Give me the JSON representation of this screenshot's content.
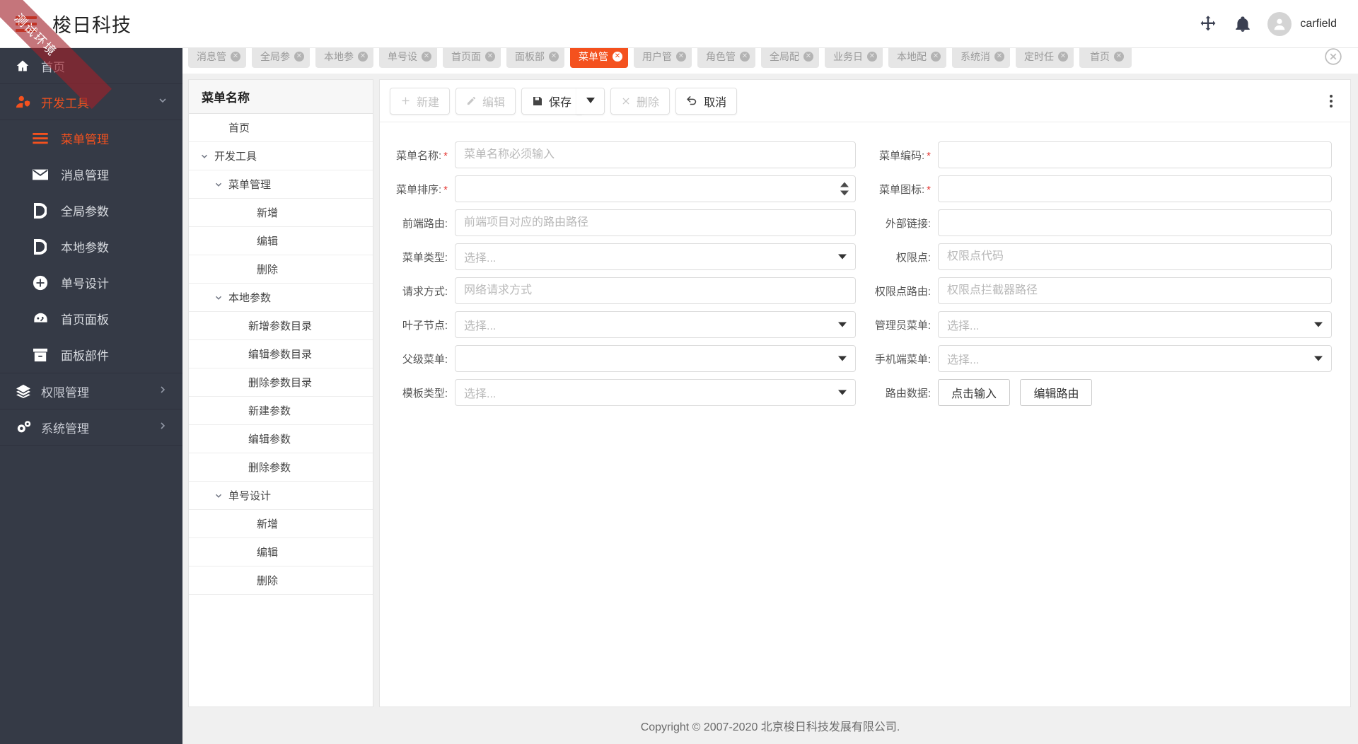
{
  "header": {
    "brand": "梭日科技",
    "user_name": "carfield",
    "menu_icon": "hamburger-icon",
    "move_icon": "move-arrows-icon",
    "bell_icon": "bell-icon",
    "avatar_icon": "user-avatar-icon"
  },
  "ribbon": {
    "text": "测试环境",
    "color": "#a2202a"
  },
  "sidebar": {
    "home": {
      "label": "首页",
      "icon": "home-icon"
    },
    "group": {
      "label": "开发工具",
      "icon": "user-shield-icon",
      "chevron": "chevron-down-icon"
    },
    "items": [
      {
        "label": "菜单管理",
        "icon": "menu-bars-icon",
        "active": true
      },
      {
        "label": "消息管理",
        "icon": "envelope-icon",
        "active": false
      },
      {
        "label": "全局参数",
        "icon": "document-icon",
        "active": false
      },
      {
        "label": "本地参数",
        "icon": "document-icon",
        "active": false
      },
      {
        "label": "单号设计",
        "icon": "plus-circle-icon",
        "active": false
      },
      {
        "label": "首页面板",
        "icon": "gauge-icon",
        "active": false
      },
      {
        "label": "面板部件",
        "icon": "box-icon",
        "active": false
      }
    ],
    "groups_bottom": [
      {
        "label": "权限管理",
        "icon": "layers-icon",
        "chevron": "chevron-right-icon"
      },
      {
        "label": "系统管理",
        "icon": "gears-icon",
        "chevron": "chevron-right-icon"
      }
    ]
  },
  "tabs": {
    "close_all_icon": "close-circle-icon",
    "items": [
      {
        "label": "消息管",
        "active": false
      },
      {
        "label": "全局参",
        "active": false
      },
      {
        "label": "本地参",
        "active": false
      },
      {
        "label": "单号设",
        "active": false
      },
      {
        "label": "首页面",
        "active": false
      },
      {
        "label": "面板部",
        "active": false
      },
      {
        "label": "菜单管",
        "active": true
      },
      {
        "label": "用户管",
        "active": false
      },
      {
        "label": "角色管",
        "active": false
      },
      {
        "label": "全局配",
        "active": false
      },
      {
        "label": "业务日",
        "active": false
      },
      {
        "label": "本地配",
        "active": false
      },
      {
        "label": "系统消",
        "active": false
      },
      {
        "label": "定时任",
        "active": false
      },
      {
        "label": "首页",
        "active": false
      }
    ]
  },
  "toolbar": {
    "new_label": "新建",
    "edit_label": "编辑",
    "save_label": "保存",
    "delete_label": "删除",
    "cancel_label": "取消",
    "new_icon": "plus-icon",
    "edit_icon": "pencil-icon",
    "save_icon": "floppy-disk-icon",
    "dropdown_icon": "caret-down-icon",
    "delete_icon": "times-icon",
    "cancel_icon": "undo-arrow-icon",
    "more_icon": "kebab-menu-icon"
  },
  "tree": {
    "header": "菜单名称",
    "rows": [
      {
        "label": "首页",
        "indent": 1,
        "caret": "none"
      },
      {
        "label": "开发工具",
        "indent": 0,
        "caret": "down"
      },
      {
        "label": "菜单管理",
        "indent": 1,
        "caret": "down"
      },
      {
        "label": "新增",
        "indent": 3,
        "caret": "none"
      },
      {
        "label": "编辑",
        "indent": 3,
        "caret": "none"
      },
      {
        "label": "删除",
        "indent": 3,
        "caret": "none"
      },
      {
        "label": "本地参数",
        "indent": 1,
        "caret": "down"
      },
      {
        "label": "新增参数目录",
        "indent": 3,
        "caret": "none"
      },
      {
        "label": "编辑参数目录",
        "indent": 3,
        "caret": "none"
      },
      {
        "label": "删除参数目录",
        "indent": 3,
        "caret": "none"
      },
      {
        "label": "新建参数",
        "indent": 3,
        "caret": "none"
      },
      {
        "label": "编辑参数",
        "indent": 3,
        "caret": "none"
      },
      {
        "label": "删除参数",
        "indent": 3,
        "caret": "none"
      },
      {
        "label": "单号设计",
        "indent": 1,
        "caret": "down"
      },
      {
        "label": "新增",
        "indent": 3,
        "caret": "none"
      },
      {
        "label": "编辑",
        "indent": 3,
        "caret": "none"
      },
      {
        "label": "删除",
        "indent": 3,
        "caret": "none"
      }
    ]
  },
  "form": {
    "left": {
      "menu_name_label": "菜单名称:",
      "menu_name_placeholder": "菜单名称必须输入",
      "menu_name_value": "",
      "menu_order_label": "菜单排序:",
      "menu_order_value": "",
      "front_route_label": "前端路由:",
      "front_route_placeholder": "前端项目对应的路由路径",
      "front_route_value": "",
      "menu_type_label": "菜单类型:",
      "menu_type_value": "选择...",
      "request_method_label": "请求方式:",
      "request_method_placeholder": "网络请求方式",
      "request_method_value": "",
      "leaf_node_label": "叶子节点:",
      "leaf_node_value": "选择...",
      "parent_menu_label": "父级菜单:",
      "parent_menu_value": "",
      "template_type_label": "模板类型:",
      "template_type_value": "选择..."
    },
    "right": {
      "menu_code_label": "菜单编码:",
      "menu_code_value": "",
      "menu_icon_label": "菜单图标:",
      "menu_icon_value": "",
      "external_link_label": "外部链接:",
      "external_link_value": "",
      "permission_point_label": "权限点:",
      "permission_point_placeholder": "权限点代码",
      "permission_point_value": "",
      "permission_route_label": "权限点路由:",
      "permission_route_placeholder": "权限点拦截器路径",
      "permission_route_value": "",
      "admin_menu_label": "管理员菜单:",
      "admin_menu_value": "选择...",
      "mobile_menu_label": "手机端菜单:",
      "mobile_menu_value": "选择...",
      "route_data_label": "路由数据:",
      "route_data_btn1": "点击输入",
      "route_data_btn2": "编辑路由"
    }
  },
  "footer": {
    "text": "Copyright © 2007-2020 北京梭日科技发展有限公司."
  },
  "colors": {
    "accent": "#f4511e",
    "sidebar_bg": "#353a46",
    "required": "#e53935"
  }
}
